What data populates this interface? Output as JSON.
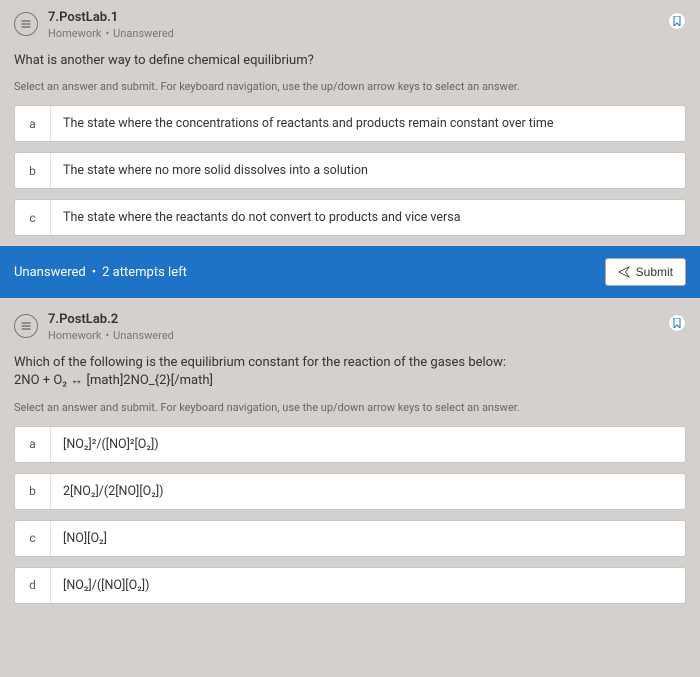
{
  "q1": {
    "id": "7.PostLab.1",
    "category": "Homework",
    "status": "Unanswered",
    "question": "What is another way to define chemical equilibrium?",
    "instruction": "Select an answer and submit. For keyboard navigation, use the up/down arrow keys to select an answer.",
    "answers": {
      "a_letter": "a",
      "a_text": "The state where the concentrations of reactants and products remain constant over time",
      "b_letter": "b",
      "b_text": "The state where no more solid dissolves into a solution",
      "c_letter": "c",
      "c_text": "The state where the reactants do not convert to products and vice versa"
    },
    "footer_status": "Unanswered",
    "footer_attempts": "2 attempts left",
    "submit_label": "Submit"
  },
  "q2": {
    "id": "7.PostLab.2",
    "category": "Homework",
    "status": "Unanswered",
    "question_prefix": "Which of the following is the equilibrium constant for the reaction of the gases below:",
    "question_eq": "2NO + O₂ ↔ [math]2NO_{2}[/math]",
    "instruction": "Select an answer and submit. For keyboard navigation, use the up/down arrow keys to select an answer.",
    "answers": {
      "a_letter": "a",
      "a_text": "[NO₂]²/([NO]²[O₂])",
      "b_letter": "b",
      "b_text": "2[NO₂]/(2[NO][O₂])",
      "c_letter": "c",
      "c_text": "[NO][O₂]",
      "d_letter": "d",
      "d_text": "[NO₂]/([NO][O₂])"
    }
  }
}
